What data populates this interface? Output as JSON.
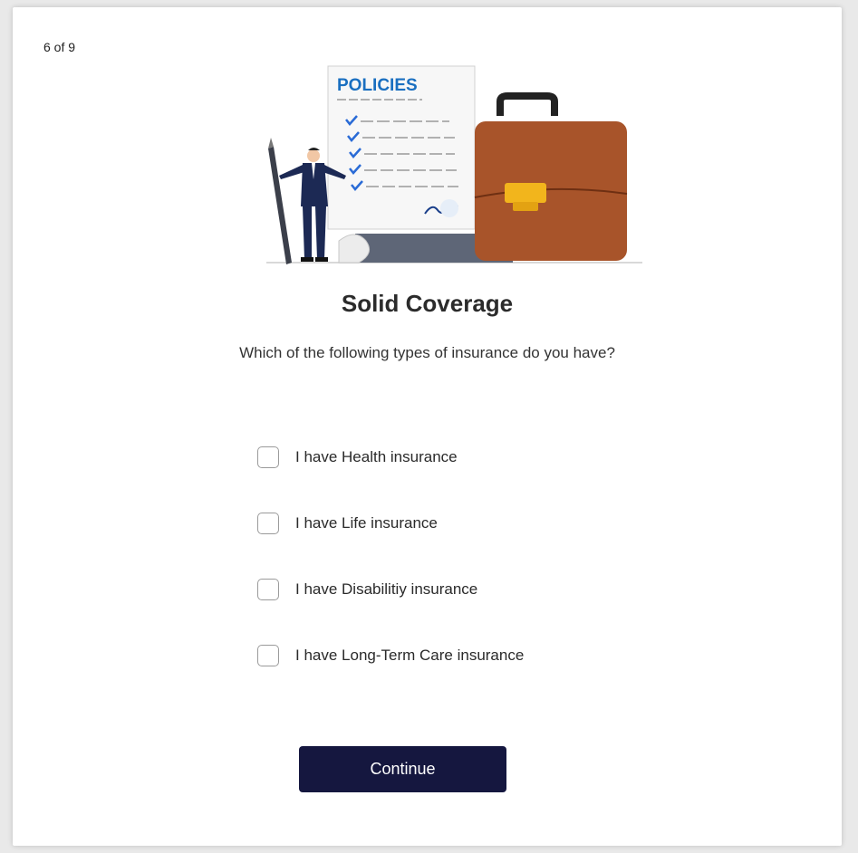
{
  "progress": {
    "text": "6 of 9"
  },
  "illustration": {
    "document_title": "POLICIES",
    "icons": [
      "businessman-figure",
      "policy-document",
      "briefcase",
      "pen",
      "checkmark-icon"
    ]
  },
  "heading": {
    "title": "Solid Coverage",
    "question": "Which of the following types of insurance do you have?"
  },
  "options": [
    {
      "label": "I have Health insurance",
      "checked": false
    },
    {
      "label": "I have Life insurance",
      "checked": false
    },
    {
      "label": "I have Disabilitiy insurance",
      "checked": false
    },
    {
      "label": "I have Long-Term Care insurance",
      "checked": false
    }
  ],
  "actions": {
    "continue_label": "Continue"
  },
  "colors": {
    "button_bg": "#15173f",
    "button_text": "#ffffff",
    "briefcase": "#a8542a",
    "briefcase_clasp": "#f2b51c",
    "document_heading": "#1a6fc0",
    "check": "#2a6bd6"
  }
}
